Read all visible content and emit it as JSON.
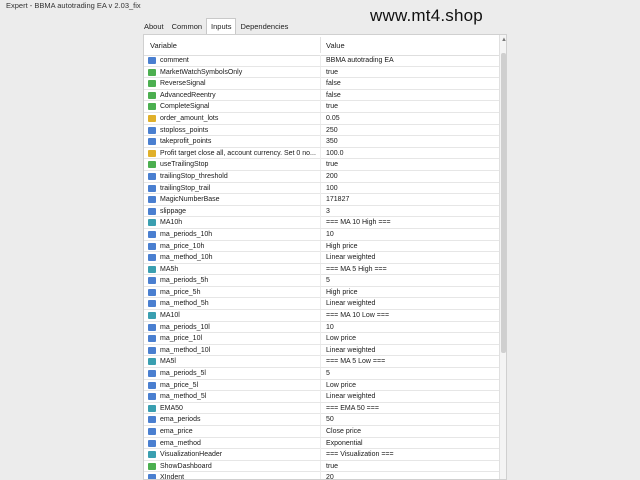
{
  "window": {
    "title": "Expert - BBMA autotrading EA v 2.03_fix"
  },
  "watermark": "www.mt4.shop",
  "tabs": [
    "About",
    "Common",
    "Inputs",
    "Dependencies"
  ],
  "table": {
    "headers": {
      "variable": "Variable",
      "value": "Value"
    },
    "rows": [
      {
        "name": "comment",
        "value": "BBMA autotrading EA",
        "icon": "string-icon",
        "color": "#4a7fd0"
      },
      {
        "name": "MarketWatchSymbolsOnly",
        "value": "true",
        "icon": "bool-icon",
        "color": "#4caf50"
      },
      {
        "name": "ReverseSignal",
        "value": "false",
        "icon": "bool-icon",
        "color": "#4caf50"
      },
      {
        "name": "AdvancedReentry",
        "value": "false",
        "icon": "bool-icon",
        "color": "#4caf50"
      },
      {
        "name": "CompleteSignal",
        "value": "true",
        "icon": "bool-icon",
        "color": "#4caf50"
      },
      {
        "name": "order_amount_lots",
        "value": "0.05",
        "icon": "double-icon",
        "color": "#e0b02a"
      },
      {
        "name": "stoploss_points",
        "value": "250",
        "icon": "int-icon",
        "color": "#4a7fd0"
      },
      {
        "name": "takeprofit_points",
        "value": "350",
        "icon": "int-icon",
        "color": "#4a7fd0"
      },
      {
        "name": "Profit target close all, account currency. Set 0 no...",
        "value": "100.0",
        "icon": "double-icon",
        "color": "#e0b02a"
      },
      {
        "name": "useTrailingStop",
        "value": "true",
        "icon": "bool-icon",
        "color": "#4caf50"
      },
      {
        "name": "trailingStop_threshold",
        "value": "200",
        "icon": "int-icon",
        "color": "#4a7fd0"
      },
      {
        "name": "trailingStop_trail",
        "value": "100",
        "icon": "int-icon",
        "color": "#4a7fd0"
      },
      {
        "name": "MagicNumberBase",
        "value": "171827",
        "icon": "int-icon",
        "color": "#4a7fd0"
      },
      {
        "name": "slippage",
        "value": "3",
        "icon": "int-icon",
        "color": "#4a7fd0"
      },
      {
        "name": "MA10h",
        "value": "=== MA 10 High ===",
        "icon": "string-icon",
        "color": "#3a9fb0"
      },
      {
        "name": "ma_periods_10h",
        "value": "10",
        "icon": "int-icon",
        "color": "#4a7fd0"
      },
      {
        "name": "ma_price_10h",
        "value": "High price",
        "icon": "enum-icon",
        "color": "#4a7fd0"
      },
      {
        "name": "ma_method_10h",
        "value": "Linear weighted",
        "icon": "enum-icon",
        "color": "#4a7fd0"
      },
      {
        "name": "MA5h",
        "value": "=== MA 5 High ===",
        "icon": "string-icon",
        "color": "#3a9fb0"
      },
      {
        "name": "ma_periods_5h",
        "value": "5",
        "icon": "int-icon",
        "color": "#4a7fd0"
      },
      {
        "name": "ma_price_5h",
        "value": "High price",
        "icon": "enum-icon",
        "color": "#4a7fd0"
      },
      {
        "name": "ma_method_5h",
        "value": "Linear weighted",
        "icon": "enum-icon",
        "color": "#4a7fd0"
      },
      {
        "name": "MA10l",
        "value": "=== MA 10 Low ===",
        "icon": "string-icon",
        "color": "#3a9fb0"
      },
      {
        "name": "ma_periods_10l",
        "value": "10",
        "icon": "int-icon",
        "color": "#4a7fd0"
      },
      {
        "name": "ma_price_10l",
        "value": "Low price",
        "icon": "enum-icon",
        "color": "#4a7fd0"
      },
      {
        "name": "ma_method_10l",
        "value": "Linear weighted",
        "icon": "enum-icon",
        "color": "#4a7fd0"
      },
      {
        "name": "MA5l",
        "value": "=== MA 5 Low ===",
        "icon": "string-icon",
        "color": "#3a9fb0"
      },
      {
        "name": "ma_periods_5l",
        "value": "5",
        "icon": "int-icon",
        "color": "#4a7fd0"
      },
      {
        "name": "ma_price_5l",
        "value": "Low price",
        "icon": "enum-icon",
        "color": "#4a7fd0"
      },
      {
        "name": "ma_method_5l",
        "value": "Linear weighted",
        "icon": "enum-icon",
        "color": "#4a7fd0"
      },
      {
        "name": "EMA50",
        "value": "=== EMA 50 ===",
        "icon": "string-icon",
        "color": "#3a9fb0"
      },
      {
        "name": "ema_periods",
        "value": "50",
        "icon": "int-icon",
        "color": "#4a7fd0"
      },
      {
        "name": "ema_price",
        "value": "Close price",
        "icon": "enum-icon",
        "color": "#4a7fd0"
      },
      {
        "name": "ema_method",
        "value": "Exponential",
        "icon": "enum-icon",
        "color": "#4a7fd0"
      },
      {
        "name": "VisualizationHeader",
        "value": "=== Visualization ===",
        "icon": "string-icon",
        "color": "#3a9fb0"
      },
      {
        "name": "ShowDashboard",
        "value": "true",
        "icon": "bool-icon",
        "color": "#4caf50"
      },
      {
        "name": "XIndent",
        "value": "20",
        "icon": "int-icon",
        "color": "#4a7fd0"
      }
    ]
  }
}
